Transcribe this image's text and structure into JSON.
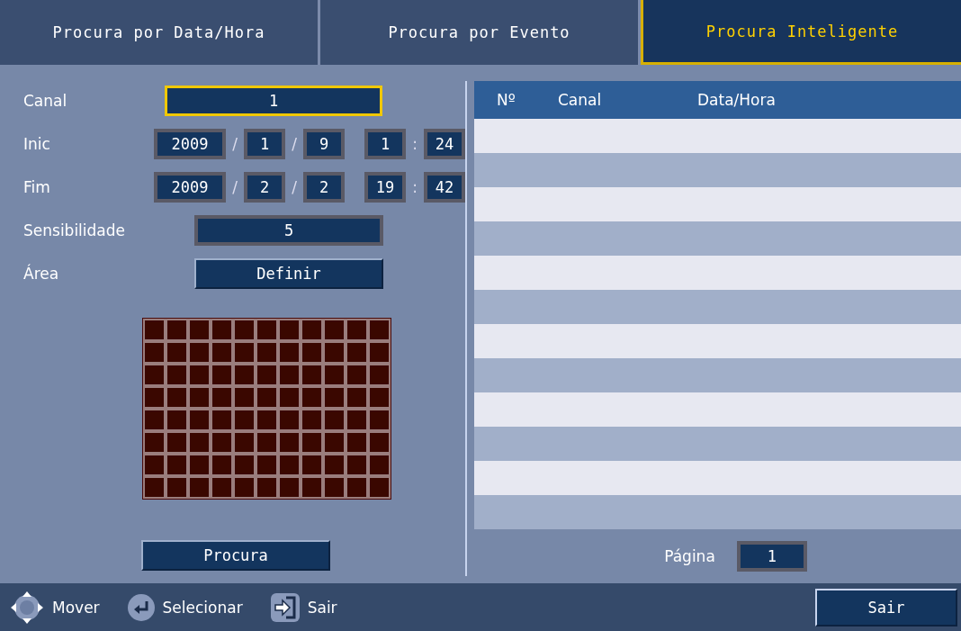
{
  "tabs": [
    {
      "label": "Procura por Data/Hora",
      "selected": false
    },
    {
      "label": "Procura por Evento",
      "selected": false
    },
    {
      "label": "Procura Inteligente",
      "selected": true
    }
  ],
  "form": {
    "channel": {
      "label": "Canal",
      "value": "1",
      "focused": true
    },
    "start": {
      "label": "Inic",
      "year": "2009",
      "month": "1",
      "day": "9",
      "hour": "1",
      "minute": "24",
      "date_sep": "/",
      "time_sep": ":"
    },
    "end": {
      "label": "Fim",
      "year": "2009",
      "month": "2",
      "day": "2",
      "hour": "19",
      "minute": "42",
      "date_sep": "/",
      "time_sep": ":"
    },
    "sensitivity": {
      "label": "Sensibilidade",
      "value": "5"
    },
    "area": {
      "label": "Área",
      "button": "Definir"
    },
    "search_button": "Procura"
  },
  "table": {
    "columns": [
      "Nº",
      "Canal",
      "Data/Hora"
    ]
  },
  "pager": {
    "label": "Página",
    "value": "1"
  },
  "footer": {
    "hints": [
      {
        "kind": "dpad",
        "label": "Mover"
      },
      {
        "kind": "enter",
        "label": "Selecionar"
      },
      {
        "kind": "exit",
        "label": "Sair"
      }
    ],
    "button": "Sair"
  }
}
